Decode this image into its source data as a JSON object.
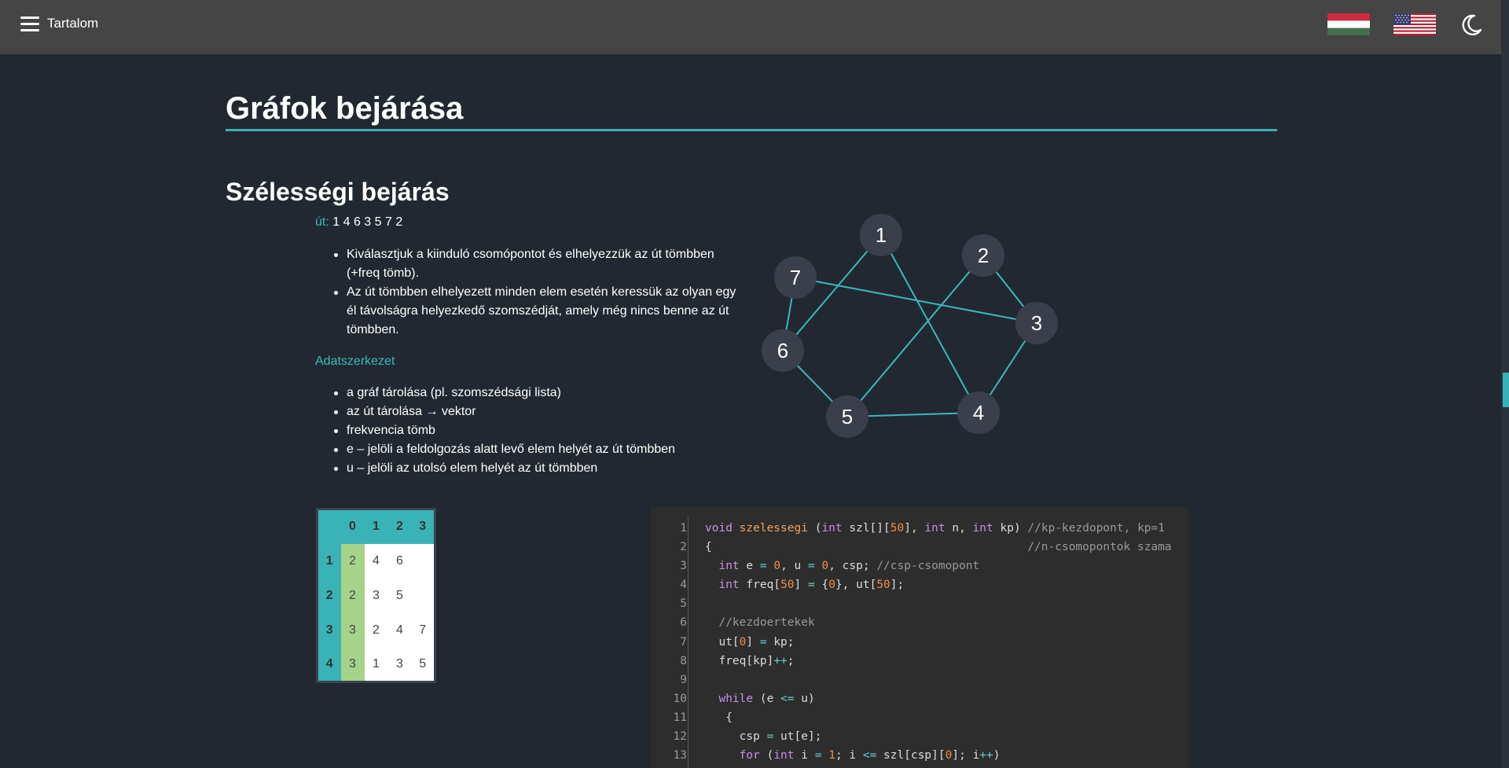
{
  "topbar": {
    "menu_label": "Tartalom"
  },
  "title": "Gráfok bejárása",
  "section_title": "Szélességi bejárás",
  "path": {
    "label": "út:",
    "value": "1 4 6 3 5 7 2"
  },
  "description": [
    "Kiválasztjuk a kiinduló csomópontot és elhelyezzük az út tömbben (+freq tömb).",
    "Az út tömbben elhelyezett minden elem esetén keressük az olyan egy él távolságra helyezkedő szomszédját, amely még nincs benne az út tömbben."
  ],
  "data_structure": {
    "title": "Adatszerkezet",
    "items": [
      "a gráf tárolása (pl. szomszédsági lista)",
      "az út tárolása → vektor",
      "frekvencia tömb",
      "e – jelöli a feldolgozás alatt levő elem helyét az út tömbben",
      "u – jelöli az utolsó elem helyét az út tömbben"
    ]
  },
  "graph": {
    "nodes": [
      "1",
      "2",
      "3",
      "4",
      "5",
      "6",
      "7"
    ],
    "edges": [
      [
        "1",
        "6"
      ],
      [
        "1",
        "4"
      ],
      [
        "2",
        "3"
      ],
      [
        "2",
        "5"
      ],
      [
        "3",
        "7"
      ],
      [
        "3",
        "4"
      ],
      [
        "4",
        "5"
      ],
      [
        "5",
        "6"
      ],
      [
        "6",
        "7"
      ]
    ],
    "edge_color": "#3bb8bd",
    "node_color": "#3a3f4b"
  },
  "adjacency_table": {
    "header": [
      "",
      "0",
      "1",
      "2",
      "3"
    ],
    "rows": [
      {
        "node": "1",
        "cells": [
          "2",
          "4",
          "6",
          ""
        ]
      },
      {
        "node": "2",
        "cells": [
          "2",
          "3",
          "5",
          ""
        ]
      },
      {
        "node": "3",
        "cells": [
          "3",
          "2",
          "4",
          "7"
        ]
      },
      {
        "node": "4",
        "cells": [
          "3",
          "1",
          "3",
          "5"
        ]
      }
    ]
  },
  "code": {
    "line_numbers": [
      "1",
      "2",
      "3",
      "4",
      "5",
      "6",
      "7",
      "8",
      "9",
      "10",
      "11",
      "12",
      "13"
    ],
    "lines": [
      "void szelessegi (int szl[][50], int n, int kp) //kp-kezdopont, kp=1",
      "{                                              //n-csomopontok szama",
      "  int e = 0, u = 0, csp; //csp-csomopont",
      "  int freq[50] = {0}, ut[50];",
      "",
      "  //kezdoertekek",
      "  ut[0] = kp;",
      "  freq[kp]++;",
      "",
      "  while (e <= u)",
      "   {",
      "     csp = ut[e];",
      "     for (int i = 1; i <= szl[csp][0]; i++)"
    ]
  },
  "colors": {
    "accent": "#3bb0b4",
    "background": "#222831",
    "topbar": "#454545"
  }
}
